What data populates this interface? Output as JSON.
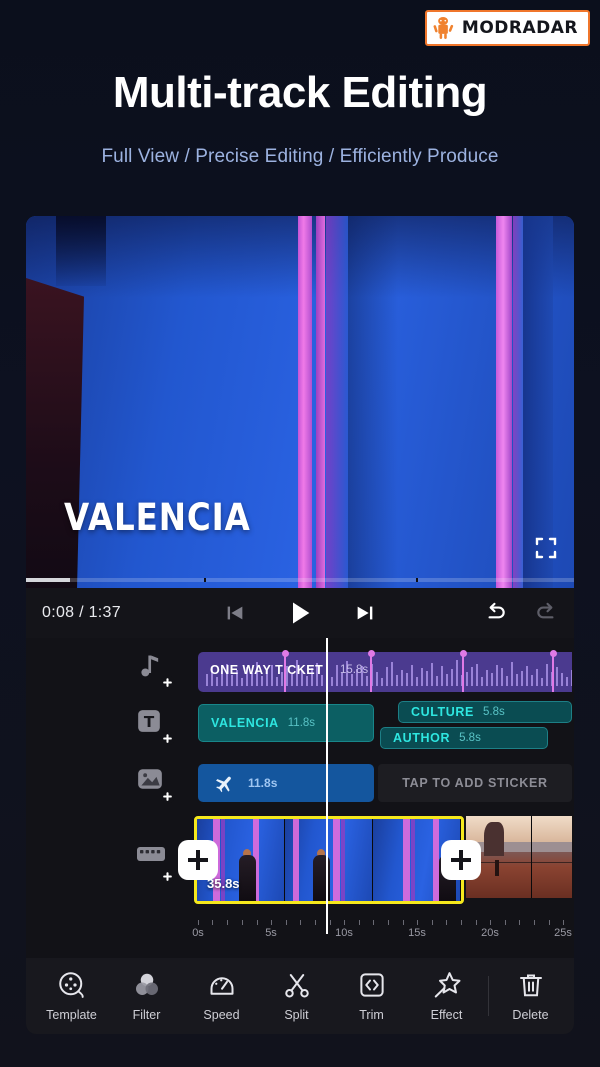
{
  "brand": {
    "name": "MODRADAR",
    "logo_icon": "android-robot-icon",
    "accent": "#f0762b"
  },
  "header": {
    "title": "Multi-track Editing",
    "subtitle": "Full View / Precise Editing / Efficiently Produce",
    "title_color": "#ffffff",
    "subtitle_color": "#9cb2e0"
  },
  "preview": {
    "overlay_text": "VALENCIA",
    "expand_icon": "fullscreen-icon",
    "progress_percent": 8
  },
  "transport": {
    "time": "0:08 / 1:37",
    "current_time": "0:08",
    "total_time": "1:37",
    "prev_icon": "skip-previous-icon",
    "play_icon": "play-icon",
    "next_icon": "skip-next-icon",
    "undo_icon": "undo-icon",
    "redo_icon": "redo-icon"
  },
  "timeline": {
    "playhead_time": "10s",
    "tracks": [
      {
        "id": "audio",
        "icon": "music-note-add-icon",
        "clip": {
          "label": "ONE WAY TICKET",
          "duration": "15.8s",
          "color": "#4b3a8f"
        },
        "beat_markers": 4
      },
      {
        "id": "text",
        "icon": "text-add-icon",
        "clips": [
          {
            "label": "VALENCIA",
            "duration": "11.8s"
          },
          {
            "label": "CULTURE",
            "duration": "5.8s"
          },
          {
            "label": "AUTHOR",
            "duration": "5.8s"
          }
        ],
        "color": "#0c5f63"
      },
      {
        "id": "sticker",
        "icon": "image-add-icon",
        "clip": {
          "sticker_icon": "airplane-icon",
          "duration": "11.8s",
          "color": "#14569e"
        },
        "placeholder": "TAP TO ADD STICKER"
      },
      {
        "id": "video",
        "icon": "film-strip-add-icon",
        "selected_clip": {
          "duration": "35.8s",
          "selected": true,
          "border_color": "#f5e81c"
        },
        "add_left_icon": "plus-icon",
        "add_right_icon": "plus-icon"
      }
    ],
    "ruler_labels": [
      "0s",
      "5s",
      "10s",
      "15s",
      "20s",
      "25s"
    ]
  },
  "toolbar": {
    "items": [
      {
        "label": "Template",
        "icon": "template-reel-icon"
      },
      {
        "label": "Filter",
        "icon": "filter-circles-icon"
      },
      {
        "label": "Speed",
        "icon": "speedometer-icon"
      },
      {
        "label": "Split",
        "icon": "scissors-icon"
      },
      {
        "label": "Trim",
        "icon": "trim-brackets-icon"
      },
      {
        "label": "Effect",
        "icon": "magic-star-icon"
      },
      {
        "label": "Delete",
        "icon": "trash-icon"
      }
    ]
  }
}
